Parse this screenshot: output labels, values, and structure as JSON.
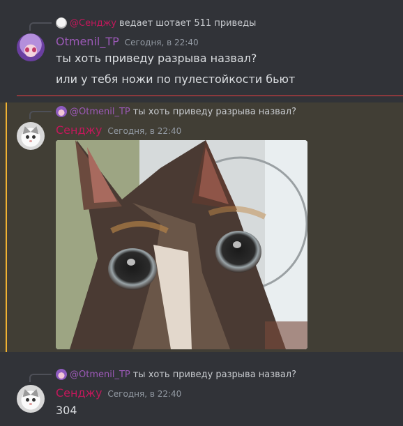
{
  "messages": [
    {
      "reply": {
        "name": "@Сенджу",
        "text": "ведает шотает 511 приведы"
      },
      "author": "Otmenil_TP",
      "timestamp": "Сегодня, в 22:40",
      "lines": [
        "ты хоть приведу разрыва назвал?",
        "или у тебя ножи по пулестойкости бьют"
      ]
    },
    {
      "reply": {
        "name": "@Otmenil_TP",
        "text": "ты хоть приведу разрыва назвал?"
      },
      "author": "Сенджу",
      "timestamp": "Сегодня, в 22:40",
      "attachment": {
        "type": "image",
        "subject": "cat-photo"
      }
    },
    {
      "reply": {
        "name": "@Otmenil_TP",
        "text": "ты хоть приведу разрыва назвал?"
      },
      "author": "Сенджу",
      "timestamp": "Сегодня, в 22:40",
      "lines": [
        "304"
      ]
    }
  ],
  "colors": {
    "background": "#313338",
    "highlight_bg": "#413e35",
    "highlight_bar": "#f0b232",
    "new_divider": "#f23f43",
    "otmenil_name": "#9b59b6",
    "sendzhu_name": "#c2185b"
  }
}
